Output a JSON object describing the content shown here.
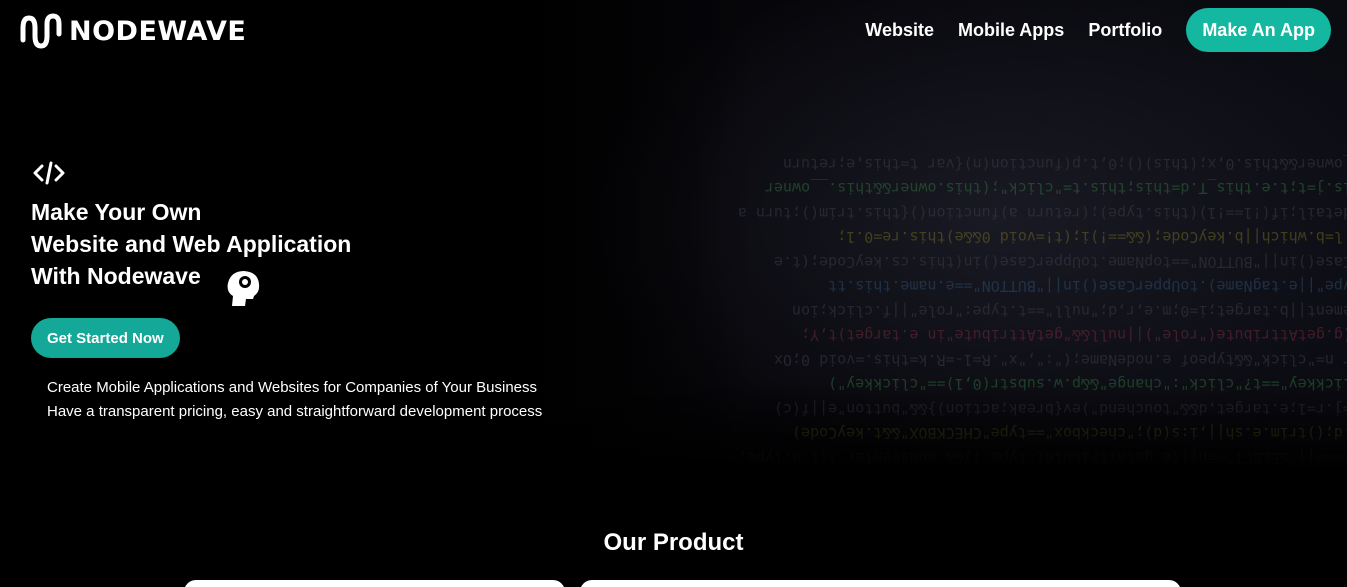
{
  "brand": {
    "name": "NODEWAVE",
    "accent_color": "#14b8a0"
  },
  "nav": {
    "links": [
      "Website",
      "Mobile Apps",
      "Portfolio"
    ],
    "cta_label": "Make An App"
  },
  "hero": {
    "icon": "code-icon",
    "title_lines": [
      "Make Your Own",
      "Website and Web Application",
      "With Nodewave"
    ],
    "decor_icon": "thinking-head-icon",
    "cta_label": "Get Started Now",
    "description_lines": [
      "Create Mobile Applications and Websites for Companies of Your Business",
      "Have a transparent pricing, easy and straightforward development process"
    ]
  },
  "products": {
    "title": "Our Product"
  }
}
